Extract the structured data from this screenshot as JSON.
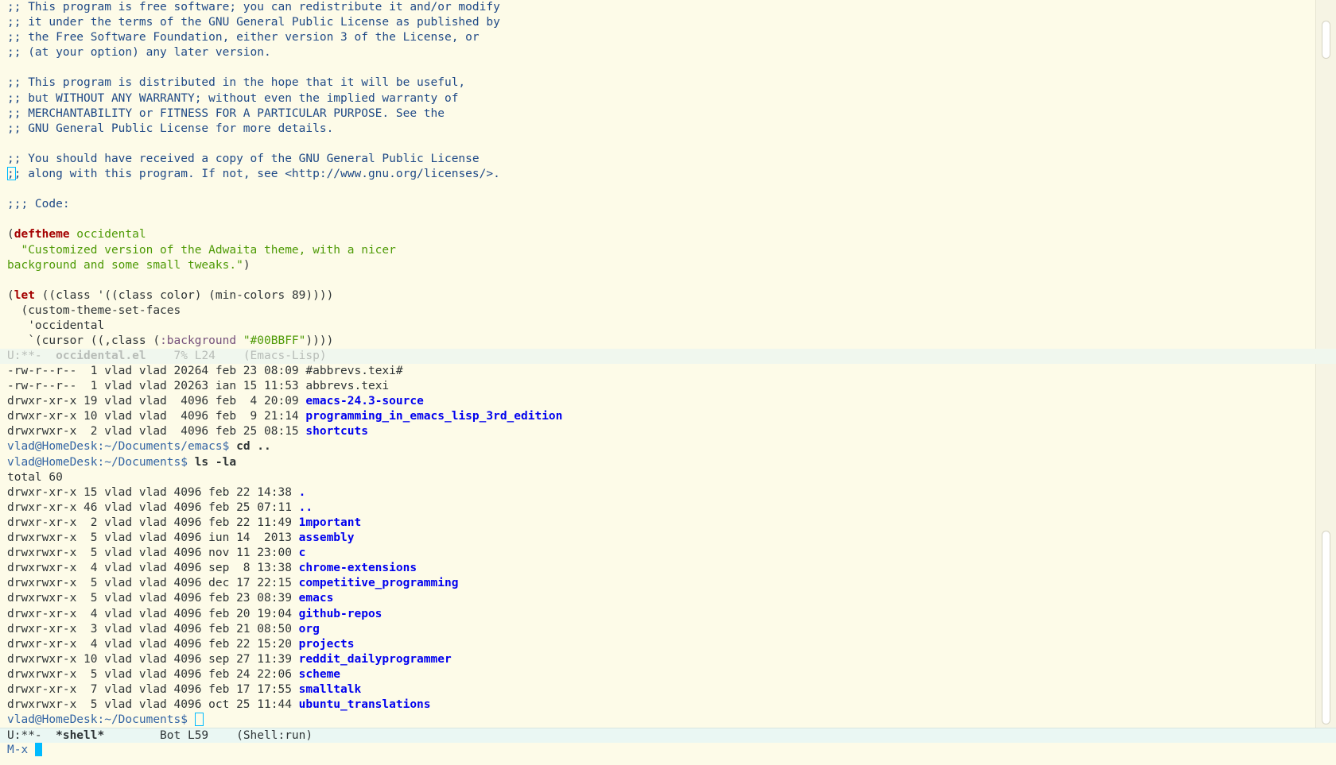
{
  "top_buffer": {
    "license_comment_1": [
      ";; This program is free software; you can redistribute it and/or modify",
      ";; it under the terms of the GNU General Public License as published by",
      ";; the Free Software Foundation, either version 3 of the License, or",
      ";; (at your option) any later version."
    ],
    "license_comment_2": [
      ";; This program is distributed in the hope that it will be useful,",
      ";; but WITHOUT ANY WARRANTY; without even the implied warranty of",
      ";; MERCHANTABILITY or FITNESS FOR A PARTICULAR PURPOSE. See the",
      ";; GNU General Public License for more details."
    ],
    "license_comment_3a": ";; You should have received a copy of the GNU General Public License",
    "license_comment_3b_char": ";",
    "license_comment_3b_rest": "; along with this program. If not, see <http://www.gnu.org/licenses/>.",
    "code_header": ";;; Code:",
    "deftheme_open": "(",
    "deftheme_kw": "deftheme",
    "deftheme_name": " occidental",
    "docstring_1": "  \"Customized version of the Adwaita theme, with a nicer",
    "docstring_2": "background and some small tweaks.\"",
    "docstring_close": ")",
    "let_open": "(",
    "let_kw": "let",
    "let_rest": " ((class '((class color) (min-colors 89))))",
    "custom_theme": "  (custom-theme-set-faces",
    "quoted_name": "   'occidental",
    "cursor_pre": "   `(cursor ((,class (",
    "cursor_key": ":background",
    "cursor_space": " ",
    "cursor_val": "\"#00BBFF\"",
    "cursor_post": "))))"
  },
  "modeline_top": {
    "status": "U:**-  ",
    "buffer_name": "occidental.el",
    "position": "    7% L24    ",
    "mode": "(Emacs-Lisp)"
  },
  "shell_buffer": {
    "listing_1": [
      {
        "meta": "-rw-r--r--  1 vlad vlad 20264 feb 23 08:09 ",
        "name": "#abbrevs.texi#",
        "is_dir": false
      },
      {
        "meta": "-rw-r--r--  1 vlad vlad 20263 ian 15 11:53 ",
        "name": "abbrevs.texi",
        "is_dir": false
      },
      {
        "meta": "drwxr-xr-x 19 vlad vlad  4096 feb  4 20:09 ",
        "name": "emacs-24.3-source",
        "is_dir": true
      },
      {
        "meta": "drwxr-xr-x 10 vlad vlad  4096 feb  9 21:14 ",
        "name": "programming_in_emacs_lisp_3rd_edition",
        "is_dir": true
      },
      {
        "meta": "drwxrwxr-x  2 vlad vlad  4096 feb 25 08:15 ",
        "name": "shortcuts",
        "is_dir": true
      }
    ],
    "prompt_1": "vlad@HomeDesk:~/Documents/emacs$ ",
    "command_1": "cd ..",
    "prompt_2": "vlad@HomeDesk:~/Documents$ ",
    "command_2": "ls -la",
    "total": "total 60",
    "listing_2": [
      {
        "meta": "drwxr-xr-x 15 vlad vlad 4096 feb 22 14:38 ",
        "name": ".",
        "is_dir": true
      },
      {
        "meta": "drwxr-xr-x 46 vlad vlad 4096 feb 25 07:11 ",
        "name": "..",
        "is_dir": true
      },
      {
        "meta": "drwxr-xr-x  2 vlad vlad 4096 feb 22 11:49 ",
        "name": "1mportant",
        "is_dir": true
      },
      {
        "meta": "drwxrwxr-x  5 vlad vlad 4096 iun 14  2013 ",
        "name": "assembly",
        "is_dir": true
      },
      {
        "meta": "drwxrwxr-x  5 vlad vlad 4096 nov 11 23:00 ",
        "name": "c",
        "is_dir": true
      },
      {
        "meta": "drwxrwxr-x  4 vlad vlad 4096 sep  8 13:38 ",
        "name": "chrome-extensions",
        "is_dir": true
      },
      {
        "meta": "drwxrwxr-x  5 vlad vlad 4096 dec 17 22:15 ",
        "name": "competitive_programming",
        "is_dir": true
      },
      {
        "meta": "drwxrwxr-x  5 vlad vlad 4096 feb 23 08:39 ",
        "name": "emacs",
        "is_dir": true
      },
      {
        "meta": "drwxr-xr-x  4 vlad vlad 4096 feb 20 19:04 ",
        "name": "github-repos",
        "is_dir": true
      },
      {
        "meta": "drwxr-xr-x  3 vlad vlad 4096 feb 21 08:50 ",
        "name": "org",
        "is_dir": true
      },
      {
        "meta": "drwxr-xr-x  4 vlad vlad 4096 feb 22 15:20 ",
        "name": "projects",
        "is_dir": true
      },
      {
        "meta": "drwxrwxr-x 10 vlad vlad 4096 sep 27 11:39 ",
        "name": "reddit_dailyprogrammer",
        "is_dir": true
      },
      {
        "meta": "drwxrwxr-x  5 vlad vlad 4096 feb 24 22:06 ",
        "name": "scheme",
        "is_dir": true
      },
      {
        "meta": "drwxr-xr-x  7 vlad vlad 4096 feb 17 17:55 ",
        "name": "smalltalk",
        "is_dir": true
      },
      {
        "meta": "drwxrwxr-x  5 vlad vlad 4096 oct 25 11:44 ",
        "name": "ubuntu_translations",
        "is_dir": true
      }
    ],
    "prompt_3": "vlad@HomeDesk:~/Documents$ "
  },
  "modeline_bottom": {
    "status": "U:**-  ",
    "buffer_name": "*shell*",
    "position": "        Bot L59    ",
    "mode": "(Shell:run)"
  },
  "minibuffer": {
    "prompt": "M-x "
  },
  "colors": {
    "background": "#fdfbe8",
    "cursor": "#00BBFF",
    "comment": "#204a87",
    "keyword": "#a40000",
    "string": "#4e9a06",
    "directory": "#0000ee",
    "prompt": "#3465a4"
  }
}
